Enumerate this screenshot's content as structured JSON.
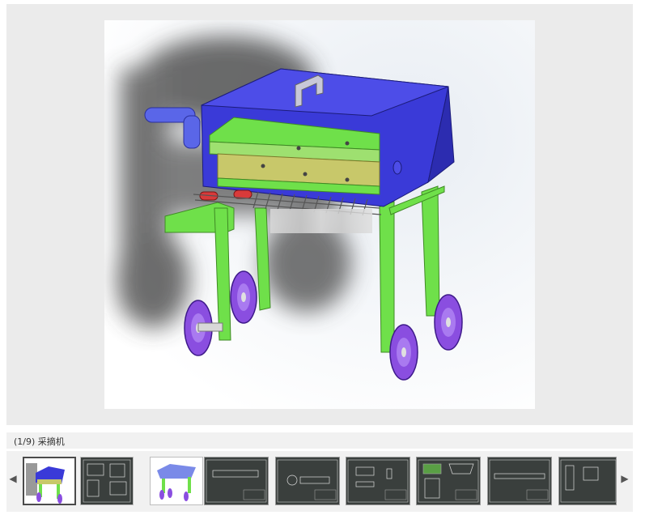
{
  "viewer": {
    "caption": "(1/9) 采摘机",
    "prev_arrow": "◀",
    "next_arrow": "▶"
  },
  "colors": {
    "body_blue": "#3a3ad8",
    "frame_green": "#6fe04a",
    "panel_olive": "#c8c86a",
    "wheel_purple": "#8a4ee0",
    "thumb_cad_bg": "#3a3f3d"
  },
  "thumbnails": [
    {
      "kind": "render",
      "active": true
    },
    {
      "kind": "cad",
      "active": false
    },
    {
      "kind": "render",
      "active": false
    },
    {
      "kind": "cad",
      "active": false
    },
    {
      "kind": "cad",
      "active": false
    },
    {
      "kind": "cad",
      "active": false
    },
    {
      "kind": "cad",
      "active": false
    },
    {
      "kind": "cad",
      "active": false
    },
    {
      "kind": "cad",
      "active": false
    }
  ]
}
